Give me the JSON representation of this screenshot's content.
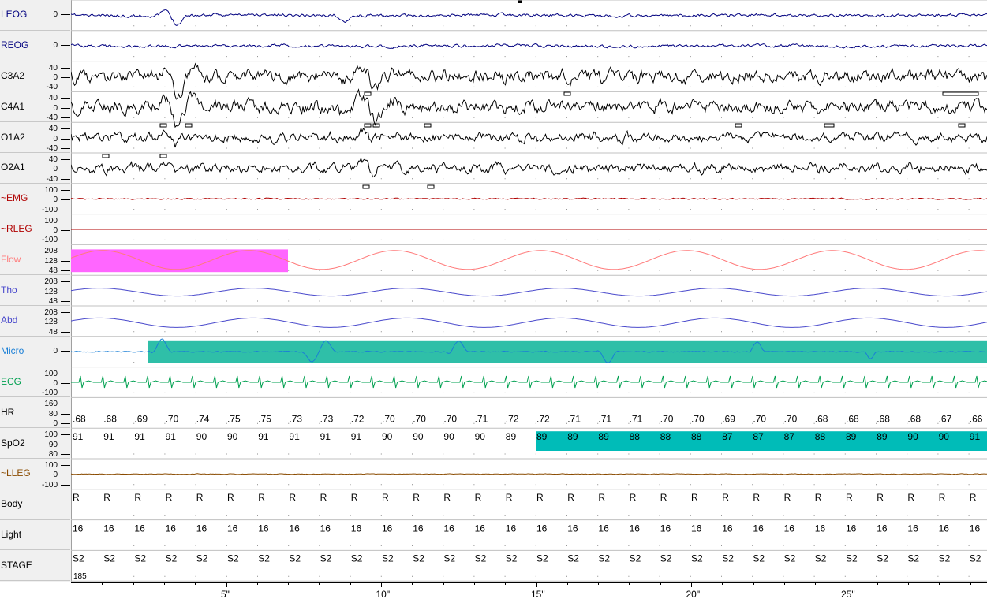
{
  "channels": [
    {
      "name": "LEOG",
      "color": "#00007f",
      "scales": [
        "0"
      ]
    },
    {
      "name": "REOG",
      "color": "#00007f",
      "scales": [
        "0"
      ]
    },
    {
      "name": "C3A2",
      "color": "#000000",
      "scales": [
        "40",
        "0",
        "-40"
      ]
    },
    {
      "name": "C4A1",
      "color": "#000000",
      "scales": [
        "40",
        "0",
        "-40"
      ]
    },
    {
      "name": "O1A2",
      "color": "#000000",
      "scales": [
        "40",
        "0",
        "-40"
      ]
    },
    {
      "name": "O2A1",
      "color": "#000000",
      "scales": [
        "40",
        "0",
        "-40"
      ]
    },
    {
      "name": "~EMG",
      "color": "#b00000",
      "scales": [
        "100",
        "0",
        "-100"
      ]
    },
    {
      "name": "~RLEG",
      "color": "#b00000",
      "scales": [
        "100",
        "0",
        "-100"
      ]
    },
    {
      "name": "Flow",
      "color": "#ff7a7a",
      "scales": [
        "208",
        "128",
        "48"
      ]
    },
    {
      "name": "Tho",
      "color": "#4a4acc",
      "scales": [
        "208",
        "128",
        "48"
      ]
    },
    {
      "name": "Abd",
      "color": "#4a4acc",
      "scales": [
        "208",
        "128",
        "48"
      ]
    },
    {
      "name": "Micro",
      "color": "#1a7fd6",
      "scales": [
        "0"
      ]
    },
    {
      "name": "ECG",
      "color": "#00a050",
      "scales": [
        "100",
        "0",
        "-100"
      ]
    },
    {
      "name": "HR",
      "color": "#000000",
      "scales": [
        "160",
        "80",
        "0"
      ]
    },
    {
      "name": "SpO2",
      "color": "#000000",
      "scales": [
        "100",
        "90",
        "80"
      ]
    },
    {
      "name": "~LLEG",
      "color": "#8a4b00",
      "scales": [
        "100",
        "0",
        "-100"
      ]
    },
    {
      "name": "Body",
      "color": "#000000",
      "scales": []
    },
    {
      "name": "Light",
      "color": "#000000",
      "scales": []
    },
    {
      "name": "STAGE",
      "color": "#000000",
      "scales": []
    }
  ],
  "hr_values": [
    ".68",
    ".68",
    ".69",
    ".70",
    ".74",
    ".75",
    ".75",
    ".73",
    ".73",
    ".72",
    ".70",
    ".70",
    ".70",
    ".71",
    ".72",
    ".72",
    ".71",
    ".71",
    ".71",
    ".70",
    ".70",
    ".69",
    ".70",
    ".70",
    ".68",
    ".68",
    ".68",
    ".68",
    ".67",
    ".66"
  ],
  "spo2_values": [
    "91",
    "91",
    "91",
    "91",
    "90",
    "90",
    "91",
    "91",
    "91",
    "91",
    "90",
    "90",
    "90",
    "90",
    "89",
    "89",
    "89",
    "89",
    "88",
    "88",
    "88",
    "87",
    "87",
    "87",
    "88",
    "89",
    "89",
    "90",
    "90",
    "91"
  ],
  "body_values": [
    "R",
    "R",
    "R",
    "R",
    "R",
    "R",
    "R",
    "R",
    "R",
    "R",
    "R",
    "R",
    "R",
    "R",
    "R",
    "R",
    "R",
    "R",
    "R",
    "R",
    "R",
    "R",
    "R",
    "R",
    "R",
    "R",
    "R",
    "R",
    "R",
    "R"
  ],
  "light_values": [
    "16",
    "16",
    "16",
    "16",
    "16",
    "16",
    "16",
    "16",
    "16",
    "16",
    "16",
    "16",
    "16",
    "16",
    "16",
    "16",
    "16",
    "16",
    "16",
    "16",
    "16",
    "16",
    "16",
    "16",
    "16",
    "16",
    "16",
    "16",
    "16",
    "16"
  ],
  "stage_values": [
    "S2",
    "S2",
    "S2",
    "S2",
    "S2",
    "S2",
    "S2",
    "S2",
    "S2",
    "S2",
    "S2",
    "S2",
    "S2",
    "S2",
    "S2",
    "S2",
    "S2",
    "S2",
    "S2",
    "S2",
    "S2",
    "S2",
    "S2",
    "S2",
    "S2",
    "S2",
    "S2",
    "S2",
    "S2",
    "S2"
  ],
  "epoch_number": "185",
  "time_labels": [
    "5\"",
    "10\"",
    "15\"",
    "20\"",
    "25\""
  ],
  "highlight_colors": {
    "flow_event": "#ff66ff",
    "snore_event": "#2fbfa8",
    "desat_event": "#00bcb8"
  }
}
